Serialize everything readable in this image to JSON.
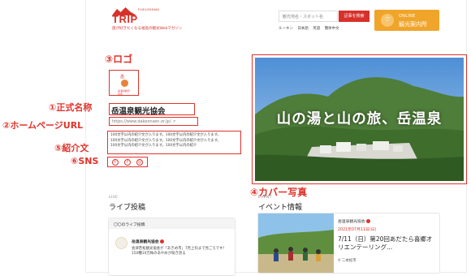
{
  "header": {
    "brand_small": "FUKUSHIMA",
    "brand": "TRIP",
    "tagline": "旅が好きだくなる福島の観光Webマガジン",
    "search_placeholder": "観光地名・スポット名",
    "search_button": "記事を検索",
    "links": [
      "ルーキン",
      "日本語",
      "英語",
      "簡体中文"
    ],
    "online_top": "ONLINE",
    "online_label": "観光案内所",
    "online_icon": "wifi-icon"
  },
  "annotations": {
    "logo": "③ロゴ",
    "official_name": "①正式名称",
    "homepage_url": "②ホームページURL",
    "intro": "⑤紹介文",
    "sns": "⑥SNS",
    "cover": "④カバー写真"
  },
  "org": {
    "logo_title": "岳",
    "logo_sub": "岳温泉観光協会",
    "name": "岳温泉観光協会",
    "url": "https://www.dakeonsen.or.jp/ ↗",
    "intro_lines": [
      "100文字以内の紹介文が入ります。100文字以内の紹介文が入ります。",
      "100文字以内の紹介文が入ります。100文字以内の紹介文が入ります。",
      "100文字以内の紹介文が入ります。100文字以内の紹介"
    ],
    "sns": [
      "twitter-icon",
      "facebook-icon",
      "instagram-icon"
    ]
  },
  "cover": {
    "title": "山の湯と山の旅、岳温泉"
  },
  "live": {
    "section_en": "LIVE",
    "section_ja": "ライブ投稿",
    "card_head": "〇〇のライブ投稿",
    "org": "岳温泉観光協会",
    "text": "会津若松観光協会が「あきめ市」7月上旬まで見ごろです！150種10万株のあやめが咲き誇る"
  },
  "event": {
    "section_en": "EVENT",
    "section_ja": "イベント情報",
    "org": "岳温泉観光協会",
    "date": "2021年07月11日(日)",
    "title": "7/11（日）第20回あだたら喜郷オリエンテーリング...",
    "place": "二本松市"
  },
  "colors": {
    "accent": "#e0332b",
    "online": "#f0a52a"
  }
}
